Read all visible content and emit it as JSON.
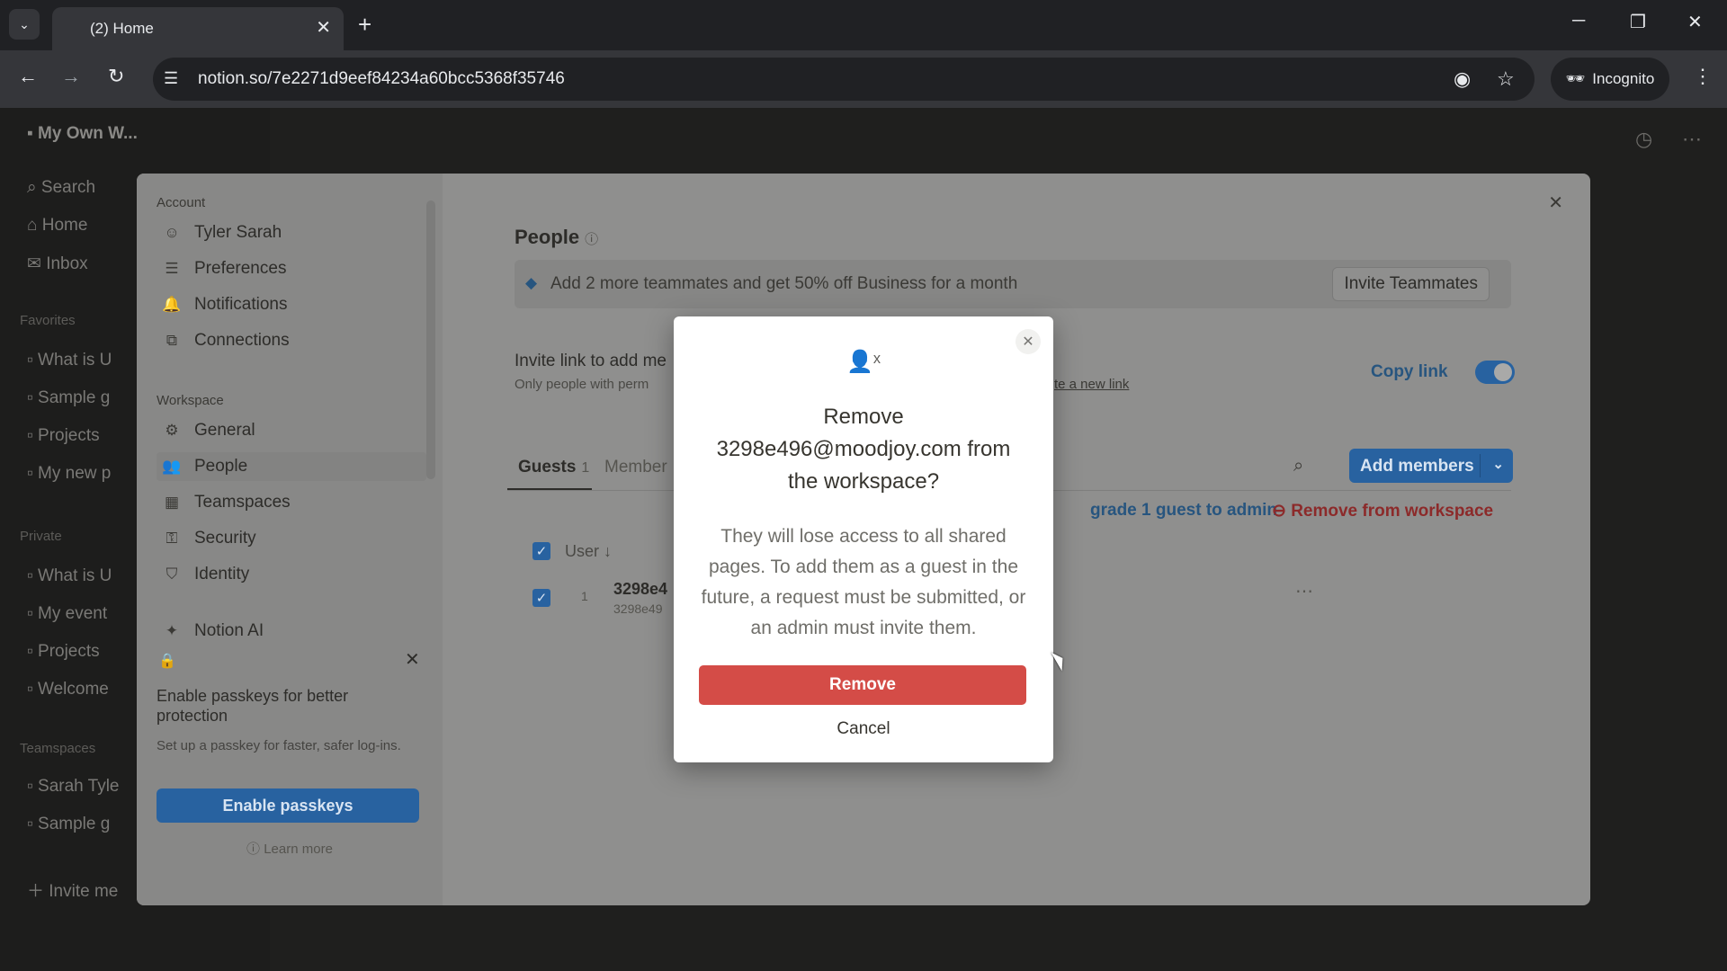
{
  "browser": {
    "tab_title": "(2) Home",
    "url": "notion.so/7e2271d9eef84234a60bcc5368f35746",
    "incognito_label": "Incognito"
  },
  "notion_sidebar": {
    "workspace_name": "My Own W...",
    "items": [
      {
        "label": "Search"
      },
      {
        "label": "Home"
      },
      {
        "label": "Inbox"
      }
    ],
    "favorites_header": "Favorites",
    "favorites": [
      "What is U",
      "Sample g",
      "Projects",
      "My new p"
    ],
    "private_header": "Private",
    "private": [
      "What is U",
      "My event",
      "Projects",
      "Welcome"
    ],
    "teamspaces_header": "Teamspaces",
    "teamspaces": [
      "Sarah Tyle",
      "Sample g"
    ],
    "invite": "Invite me"
  },
  "settings": {
    "nav": {
      "account_header": "Account",
      "account_items": [
        {
          "label": "Tyler Sarah",
          "icon": "user-icon"
        },
        {
          "label": "Preferences",
          "icon": "sliders-icon"
        },
        {
          "label": "Notifications",
          "icon": "bell-icon"
        },
        {
          "label": "Connections",
          "icon": "external-link-icon"
        }
      ],
      "workspace_header": "Workspace",
      "workspace_items": [
        {
          "label": "General",
          "icon": "gear-icon"
        },
        {
          "label": "People",
          "icon": "people-icon"
        },
        {
          "label": "Teamspaces",
          "icon": "teamspaces-icon"
        },
        {
          "label": "Security",
          "icon": "key-icon"
        },
        {
          "label": "Identity",
          "icon": "shield-check-icon"
        }
      ],
      "notion_ai": "Notion AI"
    },
    "passkey": {
      "title": "Enable passkeys for better protection",
      "subtitle": "Set up a passkey for faster, safer log-ins.",
      "button": "Enable passkeys",
      "learn_more": "Learn more"
    },
    "people": {
      "title": "People",
      "promo_text": "Add 2 more teammates and get 50% off Business for a month",
      "invite_teammates": "Invite Teammates",
      "invite_link_title": "Invite link to add me",
      "invite_link_sub": "Only people with perm",
      "new_link": "te a new link",
      "copy_link": "Copy link",
      "tabs": [
        {
          "label": "Guests",
          "count": "1"
        },
        {
          "label": "Member"
        }
      ],
      "add_members": "Add members",
      "upgrade_guest": "grade 1 guest to admin",
      "remove_from_workspace": "Remove from workspace",
      "column_user": "User ↓",
      "rows": [
        {
          "index": "1",
          "name": "3298e4",
          "email": "3298e49"
        }
      ]
    }
  },
  "dialog": {
    "title": "Remove 3298e496@moodjoy.com from the workspace?",
    "body": "They will lose access to all shared pages. To add them as a guest in the future, a request must be submitted, or an admin must invite them.",
    "remove_button": "Remove",
    "cancel_button": "Cancel"
  },
  "colors": {
    "danger": "#d44c47",
    "accent": "#2862a0"
  }
}
